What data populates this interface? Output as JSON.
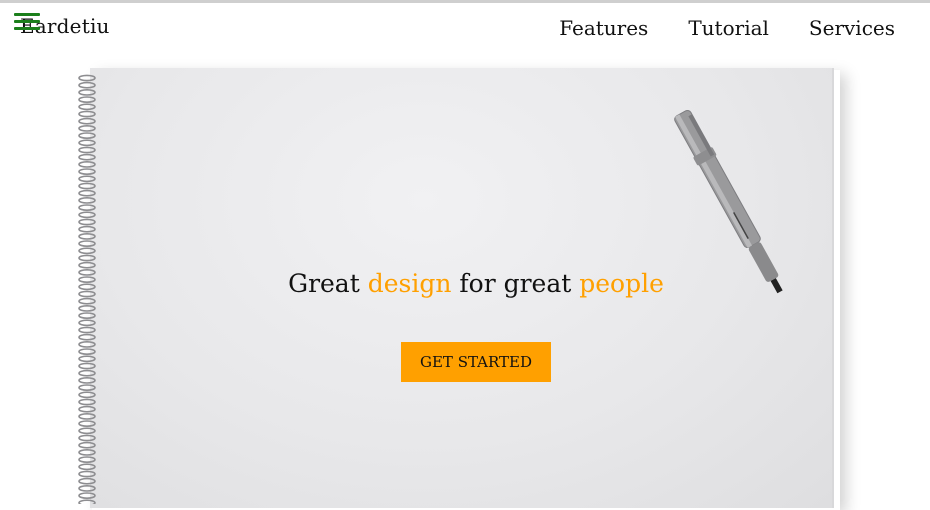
{
  "navbar": {
    "brand": "Eardetiu",
    "links": [
      {
        "label": "Features"
      },
      {
        "label": "Tutorial"
      },
      {
        "label": "Services"
      }
    ],
    "menu_icon": "hamburger-icon",
    "menu_icon_color": "#1c7f1c"
  },
  "hero": {
    "title_parts": [
      "Great ",
      "design",
      " for great ",
      "people"
    ],
    "accent_color": "#ffa000",
    "cta_label": "GET STARTED"
  }
}
